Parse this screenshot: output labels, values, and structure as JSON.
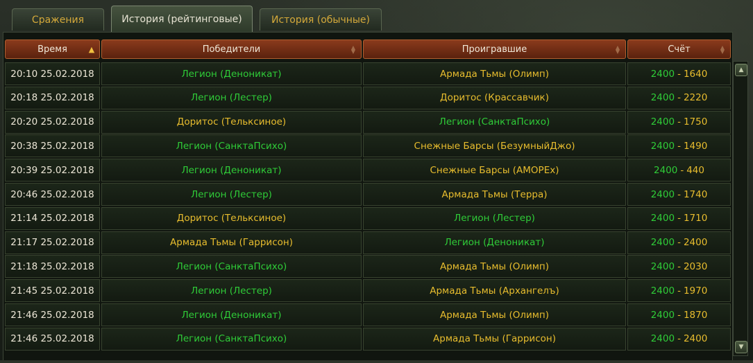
{
  "tabs": [
    {
      "label": "Сражения",
      "active": false
    },
    {
      "label": "История (рейтинговые)",
      "active": true
    },
    {
      "label": "История (обычные)",
      "active": false
    }
  ],
  "columns": {
    "time": "Время",
    "winners": "Победители",
    "losers": "Проигравшие",
    "score": "Счёт"
  },
  "sort_icons": {
    "active": "arrow-up-icon",
    "inactive": "sort-arrows-icon"
  },
  "colors": {
    "green": "#2fcc38",
    "gold": "#e8bd2e"
  },
  "rows": [
    {
      "time": "20:10 25.02.2018",
      "winner": "Легион (Деноникат)",
      "loser": "Армада Тьмы (Олимп)",
      "score_a": "2400",
      "score_b": "1640",
      "winner_color": "green",
      "loser_color": "gold"
    },
    {
      "time": "20:18 25.02.2018",
      "winner": "Легион (Лестер)",
      "loser": "Доритос (Крассавчик)",
      "score_a": "2400",
      "score_b": "2220",
      "winner_color": "green",
      "loser_color": "gold"
    },
    {
      "time": "20:20 25.02.2018",
      "winner": "Доритос (Тельксиное)",
      "loser": "Легион (СанктаПсихо)",
      "score_a": "2400",
      "score_b": "1750",
      "winner_color": "gold",
      "loser_color": "green"
    },
    {
      "time": "20:38 25.02.2018",
      "winner": "Легион (СанктаПсихо)",
      "loser": "Снежные Барсы (БезумныйДжо)",
      "score_a": "2400",
      "score_b": "1490",
      "winner_color": "green",
      "loser_color": "gold"
    },
    {
      "time": "20:39 25.02.2018",
      "winner": "Легион (Деноникат)",
      "loser": "Снежные Барсы (AMOPEx)",
      "score_a": "2400",
      "score_b": "440",
      "winner_color": "green",
      "loser_color": "gold"
    },
    {
      "time": "20:46 25.02.2018",
      "winner": "Легион (Лестер)",
      "loser": "Армада Тьмы (Терра)",
      "score_a": "2400",
      "score_b": "1740",
      "winner_color": "green",
      "loser_color": "gold"
    },
    {
      "time": "21:14 25.02.2018",
      "winner": "Доритос (Тельксиное)",
      "loser": "Легион (Лестер)",
      "score_a": "2400",
      "score_b": "1710",
      "winner_color": "gold",
      "loser_color": "green"
    },
    {
      "time": "21:17 25.02.2018",
      "winner": "Армада Тьмы (Гаррисон)",
      "loser": "Легион (Деноникат)",
      "score_a": "2400",
      "score_b": "2400",
      "winner_color": "gold",
      "loser_color": "green"
    },
    {
      "time": "21:18 25.02.2018",
      "winner": "Легион (СанктаПсихо)",
      "loser": "Армада Тьмы (Олимп)",
      "score_a": "2400",
      "score_b": "2030",
      "winner_color": "green",
      "loser_color": "gold"
    },
    {
      "time": "21:45 25.02.2018",
      "winner": "Легион (Лестер)",
      "loser": "Армада Тьмы (Архангелъ)",
      "score_a": "2400",
      "score_b": "1970",
      "winner_color": "green",
      "loser_color": "gold"
    },
    {
      "time": "21:46 25.02.2018",
      "winner": "Легион (Деноникат)",
      "loser": "Армада Тьмы (Олимп)",
      "score_a": "2400",
      "score_b": "1870",
      "winner_color": "green",
      "loser_color": "gold"
    },
    {
      "time": "21:46 25.02.2018",
      "winner": "Легион (СанктаПсихо)",
      "loser": "Армада Тьмы (Гаррисон)",
      "score_a": "2400",
      "score_b": "2400",
      "winner_color": "green",
      "loser_color": "gold"
    }
  ]
}
